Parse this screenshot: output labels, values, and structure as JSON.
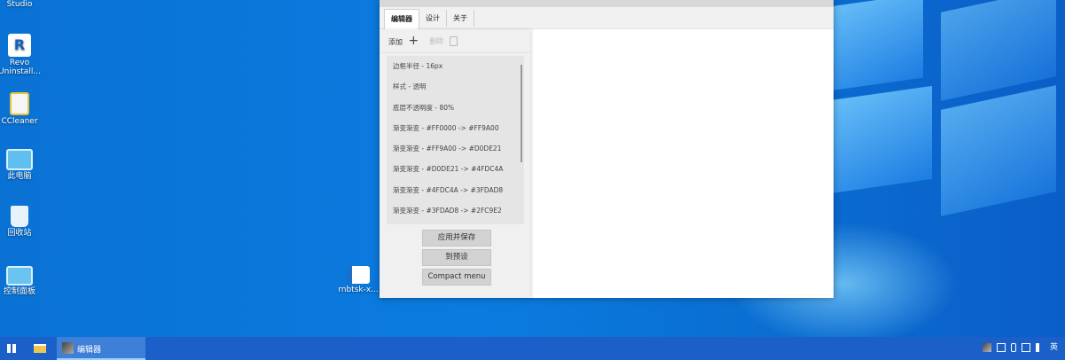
{
  "desktop": {
    "icons": [
      {
        "label": "Studio"
      },
      {
        "label": "Revo\nUninstall..."
      },
      {
        "label": "CCleaner"
      },
      {
        "label": "此电脑"
      },
      {
        "label": "回收站"
      },
      {
        "label": "控制面板"
      },
      {
        "label": "rnbtsk-x..."
      }
    ]
  },
  "window": {
    "tabs": [
      {
        "label": "编辑器",
        "active": true
      },
      {
        "label": "设计"
      },
      {
        "label": "关于"
      }
    ],
    "toolbar": {
      "add_label": "添加",
      "add_icon": "plus-icon",
      "delete_label": "删除",
      "delete_icon": "trash-icon"
    },
    "list": [
      "边框半径 - 16px",
      "样式 - 透明",
      "底层不透明度 - 80%",
      "渐变渐变 - #FF0000 -> #FF9A00",
      "渐变渐变 - #FF9A00 -> #D0DE21",
      "渐变渐变 - #D0DE21 -> #4FDC4A",
      "渐变渐变 - #4FDC4A -> #3FDAD8",
      "渐变渐变 - #3FDAD8 -> #2FC9E2"
    ],
    "buttons": {
      "apply": "应用并保存",
      "preset": "到预设",
      "compact": "Compact menu"
    }
  },
  "taskbar": {
    "app_label": "编辑器",
    "tray_lang": "英"
  },
  "colors": {
    "desktop": "#0b74d8",
    "taskbar": "#1a60c8"
  }
}
